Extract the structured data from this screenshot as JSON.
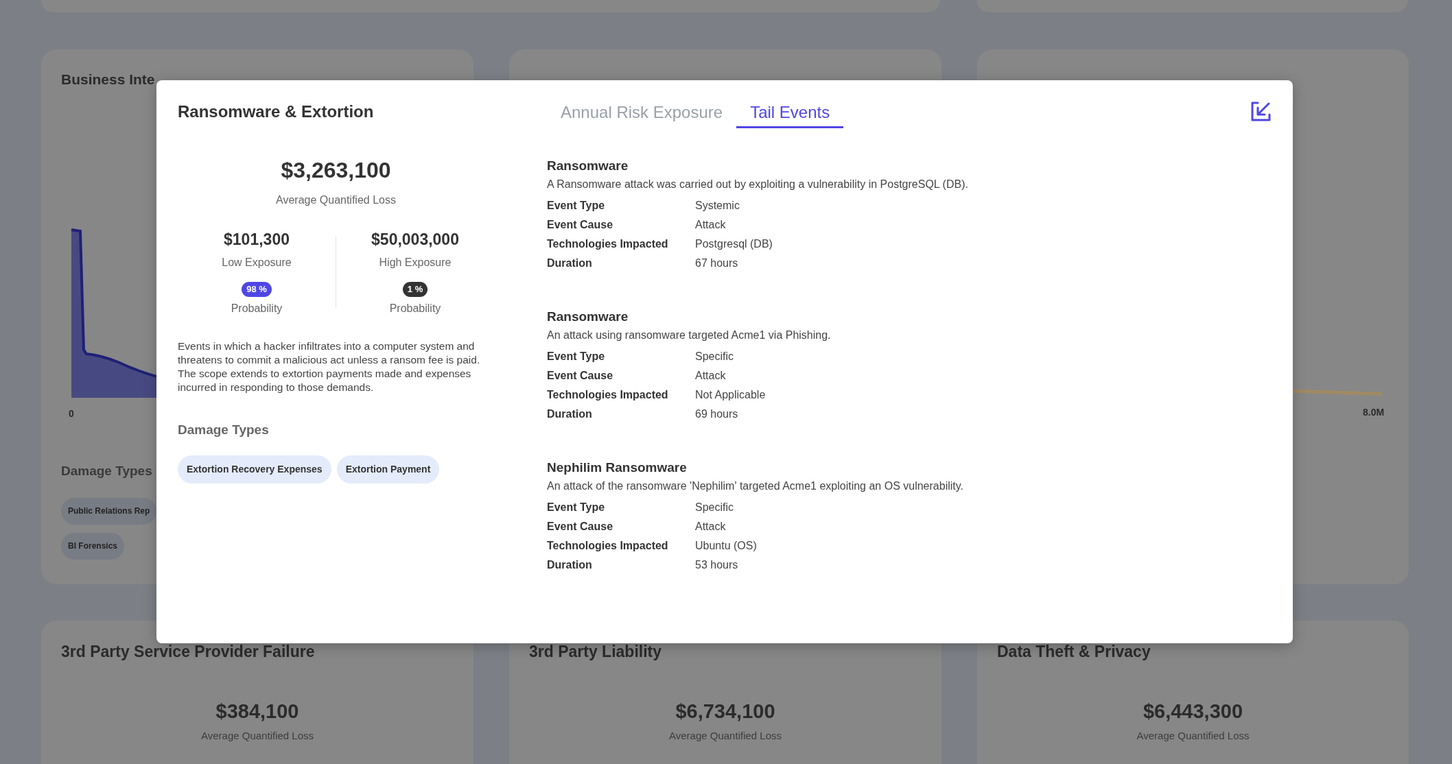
{
  "row_cards": [
    {
      "kind": "area",
      "title": "Business Inte",
      "axis_label": "0",
      "section_title": "Damage Types",
      "chips": [
        "Public Relations Rep",
        "BI Forensics"
      ]
    },
    {
      "kind": "blank"
    },
    {
      "kind": "line",
      "axis_label": "8.0M"
    }
  ],
  "bottom_cards": [
    {
      "title": "3rd Party Service Provider Failure",
      "amount": "$384,100",
      "caption": "Average Quantified Loss"
    },
    {
      "title": "3rd Party Liability",
      "amount": "$6,734,100",
      "caption": "Average Quantified Loss"
    },
    {
      "title": "Data Theft & Privacy",
      "amount": "$6,443,300",
      "caption": "Average Quantified Loss"
    }
  ],
  "modal": {
    "title": "Ransomware & Extortion",
    "average_loss": "$3,263,100",
    "average_label": "Average Quantified Loss",
    "exposures": [
      {
        "value": "$101,300",
        "label": "Low Exposure",
        "probability": "98 %",
        "probability_label": "Probability",
        "color": "#4f46e5"
      },
      {
        "value": "$50,003,000",
        "label": "High Exposure",
        "probability": "1 %",
        "probability_label": "Probability",
        "color": "#333333"
      }
    ],
    "description": "Events in which a hacker infiltrates into a computer system and threatens to commit a malicious act unless a ransom fee is paid. The scope extends to extortion payments made and expenses incurred in responding to those demands.",
    "damage_title": "Damage Types",
    "damage_types": [
      "Extortion Recovery Expenses",
      "Extortion Payment"
    ],
    "tabs": [
      {
        "label": "Annual Risk Exposure",
        "selected": false
      },
      {
        "label": "Tail Events",
        "selected": true
      }
    ],
    "events": [
      {
        "title": "Ransomware",
        "description": "A Ransomware attack was carried out by exploiting a vulnerability in PostgreSQL (DB).",
        "fields": [
          {
            "label": "Event Type",
            "value": "Systemic"
          },
          {
            "label": "Event Cause",
            "value": "Attack"
          },
          {
            "label": "Technologies Impacted",
            "value": "Postgresql (DB)"
          },
          {
            "label": "Duration",
            "value": "67 hours"
          }
        ]
      },
      {
        "title": "Ransomware",
        "description": "An attack using ransomware targeted Acme1 via Phishing.",
        "fields": [
          {
            "label": "Event Type",
            "value": "Specific"
          },
          {
            "label": "Event Cause",
            "value": "Attack"
          },
          {
            "label": "Technologies Impacted",
            "value": "Not Applicable"
          },
          {
            "label": "Duration",
            "value": "69 hours"
          }
        ]
      },
      {
        "title": "Nephilim Ransomware",
        "description": "An attack of the ransomware 'Nephilim' targeted Acme1 exploiting an OS vulnerability.",
        "fields": [
          {
            "label": "Event Type",
            "value": "Specific"
          },
          {
            "label": "Event Cause",
            "value": "Attack"
          },
          {
            "label": "Technologies Impacted",
            "value": "Ubuntu (OS)"
          },
          {
            "label": "Duration",
            "value": "53 hours"
          }
        ]
      }
    ]
  }
}
